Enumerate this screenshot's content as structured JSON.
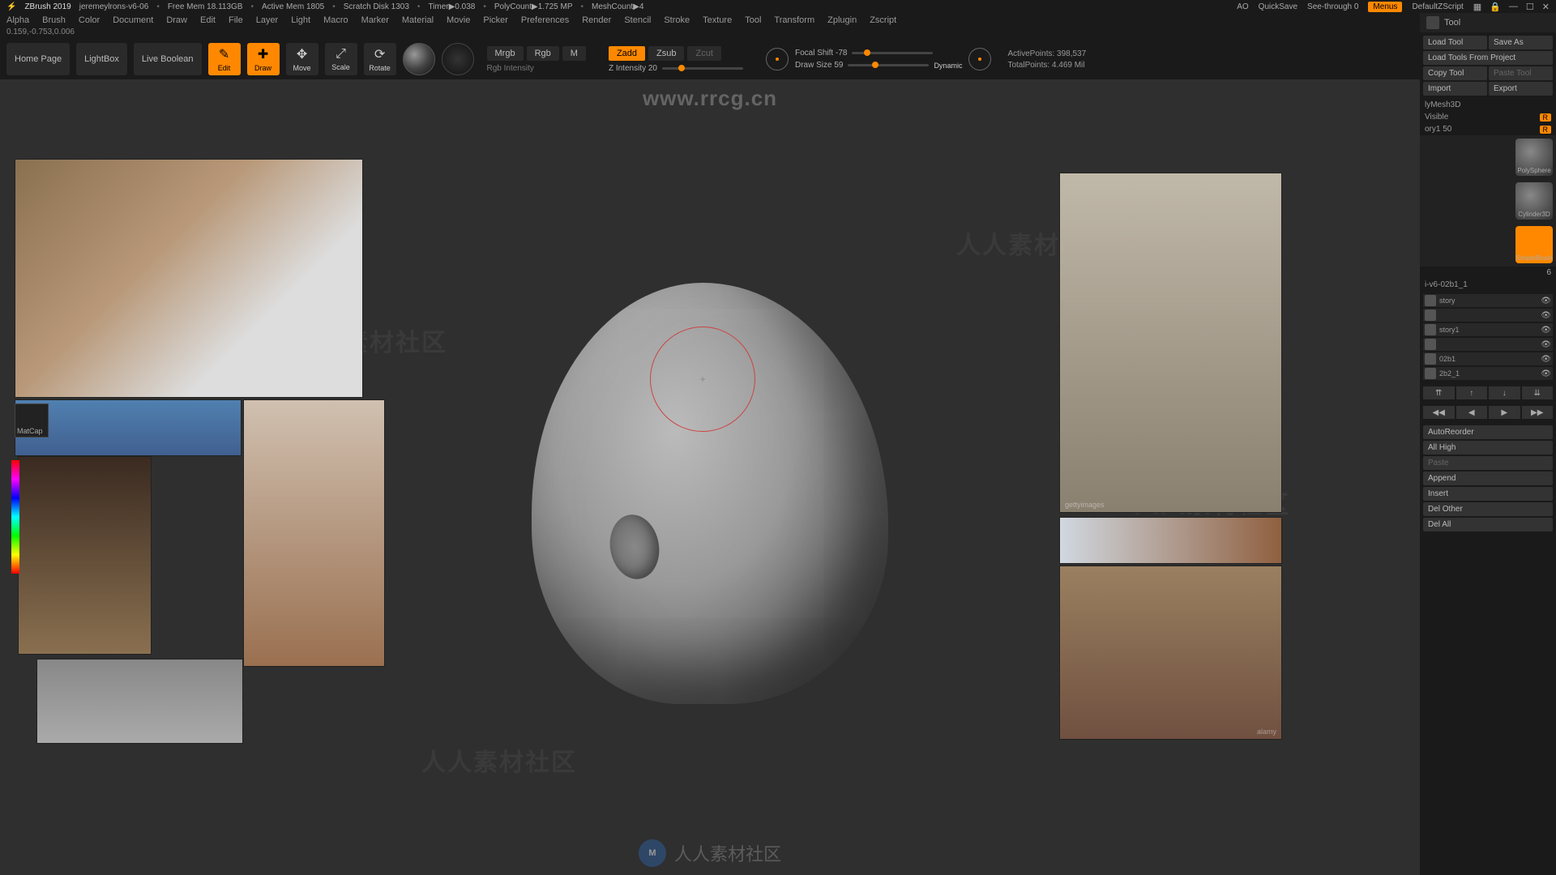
{
  "title": {
    "app": "ZBrush 2019",
    "file": "jeremeylrons-v6-06",
    "freemem": "Free Mem 18.113GB",
    "activemem": "Active Mem 1805",
    "scratch": "Scratch Disk 1303",
    "timer": "Timer▶0.038",
    "polycount": "PolyCount▶1.725 MP",
    "meshcount": "MeshCount▶4",
    "ao": "AO",
    "quicksave": "QuickSave",
    "seethrough": "See-through  0",
    "menus": "Menus",
    "zscript": "DefaultZScript"
  },
  "menus": [
    "Alpha",
    "Brush",
    "Color",
    "Document",
    "Draw",
    "Edit",
    "File",
    "Layer",
    "Light",
    "Macro",
    "Marker",
    "Material",
    "Movie",
    "Picker",
    "Preferences",
    "Render",
    "Stencil",
    "Stroke",
    "Texture",
    "Tool",
    "Transform",
    "Zplugin",
    "Zscript"
  ],
  "coords": "0.159,-0.753,0.006",
  "toolbar": {
    "home": "Home Page",
    "lightbox": "LightBox",
    "liveboolean": "Live Boolean",
    "edit": "Edit",
    "draw": "Draw",
    "move": "Move",
    "scale": "Scale",
    "rotate": "Rotate",
    "mrgb": "Mrgb",
    "rgb": "Rgb",
    "m": "M",
    "rgbint": "Rgb Intensity",
    "zadd": "Zadd",
    "zsub": "Zsub",
    "zcut": "Zcut",
    "zint": "Z Intensity 20",
    "focal": "Focal Shift -78",
    "drawsize": "Draw Size 59",
    "dynamic": "Dynamic",
    "activepoints": "ActivePoints: 398,537",
    "totalpoints": "TotalPoints: 4.469 Mil"
  },
  "tool": {
    "header": "Tool",
    "load": "Load Tool",
    "saveas": "Save As",
    "loadproj": "Load Tools From Project",
    "copy": "Copy Tool",
    "paste": "Paste Tool",
    "import": "Import",
    "export": "Export",
    "polymesh": "lyMesh3D",
    "visible": "Visible",
    "r": "R",
    "mem1": "ory1  50",
    "previews": [
      "PolySphere",
      "Cylinder3D",
      "SimpleBrush"
    ],
    "count6": "6",
    "item1": "i-v6-02b1_1",
    "hist": "story",
    "hist1": "story1",
    "i02b1": "02b1",
    "i2b2": "2b2_1",
    "autoreorder": "AutoReorder",
    "allhigh": "All High",
    "pastebtn": "Paste",
    "append": "Append",
    "insert": "Insert",
    "delother": "Del Other",
    "delall": "Del All"
  },
  "refs": {
    "matcap": "MatCap",
    "getty": "gettyimages",
    "alamy": "alamy"
  },
  "watermark": {
    "url": "www.rrcg.cn",
    "text": "人人素材社区"
  }
}
